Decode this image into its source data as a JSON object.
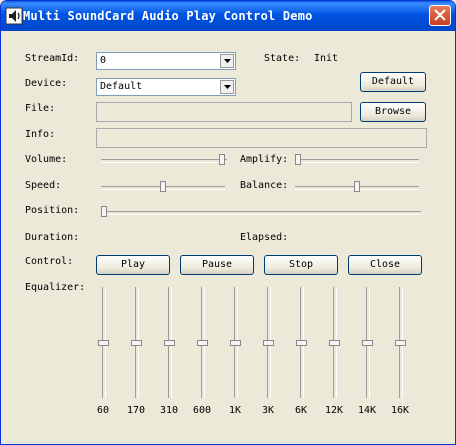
{
  "window": {
    "title": "Multi SoundCard Audio Play Control Demo"
  },
  "labels": {
    "streamid": "StreamId:",
    "state": "State:",
    "state_value": "Init",
    "device": "Device:",
    "file": "File:",
    "info": "Info:",
    "volume": "Volume:",
    "amplify": "Amplify:",
    "speed": "Speed:",
    "balance": "Balance:",
    "position": "Position:",
    "duration": "Duration:",
    "elapsed": "Elapsed:",
    "control": "Control:",
    "equalizer": "Equalizer:"
  },
  "fields": {
    "streamid_value": "0",
    "device_value": "Default",
    "file_value": "",
    "info_value": ""
  },
  "buttons": {
    "default": "Default",
    "browse": "Browse",
    "play": "Play",
    "pause": "Pause",
    "stop": "Stop",
    "close": "Close"
  },
  "sliders": {
    "volume": 0.98,
    "amplify": 0.0,
    "speed": 0.5,
    "balance": 0.5,
    "position": 0.0
  },
  "equalizer": {
    "bands": [
      "60",
      "170",
      "310",
      "600",
      "1K",
      "3K",
      "6K",
      "12K",
      "14K",
      "16K"
    ],
    "levels": [
      0.5,
      0.5,
      0.5,
      0.5,
      0.5,
      0.5,
      0.5,
      0.5,
      0.5,
      0.5
    ]
  }
}
